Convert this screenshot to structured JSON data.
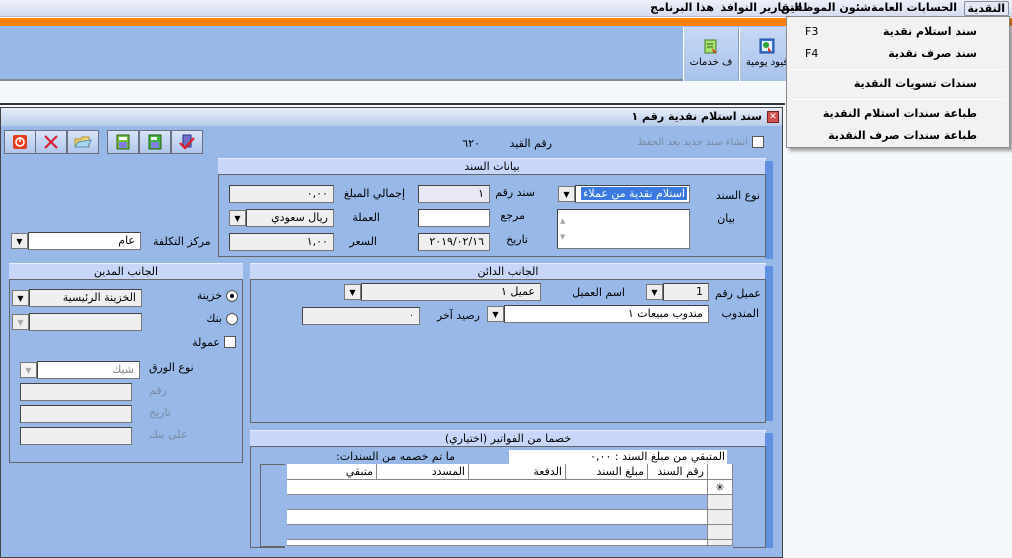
{
  "menubar": {
    "items": [
      {
        "label": "النقدية",
        "active": true
      },
      {
        "label": "الحسابات العامة"
      },
      {
        "label": "شئون الموظفين"
      },
      {
        "label": "التقارير"
      },
      {
        "label": "النوافذ"
      },
      {
        "label": "هذا البرنامج"
      }
    ]
  },
  "ribbon": {
    "buttons": [
      {
        "label": "قيود يومية",
        "icon": "journal-entries-icon"
      },
      {
        "label": "ف خدمات",
        "icon": "services-icon"
      }
    ]
  },
  "dropdown": {
    "items": [
      {
        "label": "سند استلام نقدية",
        "shortcut": "F3"
      },
      {
        "label": "سند صرف نقدية",
        "shortcut": "F4"
      },
      {
        "label": "سندات تسويات النقدية",
        "shortcut": ""
      },
      {
        "label": "طباعة سندات استلام النقدية",
        "shortcut": ""
      },
      {
        "label": "طباعة سندات صرف النقدية",
        "shortcut": ""
      }
    ]
  },
  "window": {
    "title": "سند استلام نقدية رقم ١",
    "close_glyph": "✕",
    "create_new_after_save_label": "انشاء سند جديد بعد الحفظ",
    "entry_number_label": "رقم القيد",
    "entry_number_value": "٦٢٠",
    "toolbar": [
      {
        "name": "exit-icon",
        "glyph": "⏻"
      },
      {
        "name": "delete-icon",
        "glyph": "✕"
      },
      {
        "name": "open-folder-icon",
        "glyph": "📂"
      },
      {
        "name": "save-new-icon",
        "glyph": "💾"
      },
      {
        "name": "save-icon",
        "glyph": "💾"
      },
      {
        "name": "post-approve-icon",
        "glyph": "✔"
      }
    ]
  },
  "voucher_data": {
    "header": "بيانات السند",
    "type_label": "نوع السند",
    "type_value": "استلام نقدية من عملاء",
    "description_label": "بيان",
    "description_value": "",
    "number_label": "سند رقم",
    "number_value": "١",
    "reference_label": "مرجع",
    "reference_value": "",
    "date_label": "تاريخ",
    "date_value": "٢٠١٩/٠٢/١٦",
    "total_label": "إجمالي المبلغ",
    "total_value": "٠,٠٠",
    "currency_label": "العملة",
    "currency_value": "ريال سعودي",
    "rate_label": "السعر",
    "rate_value": "١,٠٠"
  },
  "cost_center": {
    "label": "مركز التكلفة",
    "value": "عام"
  },
  "debit_side": {
    "header": "الجانب المدين",
    "treasury_label": "خزينة",
    "treasury_selected": true,
    "treasury_value": "الخزينة الرئيسية",
    "bank_label": "بنك",
    "bank_value": "",
    "commission_label": "عمولة",
    "paper_type_label": "نوع الورق",
    "paper_type_value": "شيك",
    "number_label": "رقم",
    "date_label": "تاريخ",
    "on_bank_label": "على بنك"
  },
  "credit_side": {
    "header": "الجانب الدائن",
    "customer_number_label": "عميل رقم",
    "customer_number_value": "1",
    "customer_name_label": "اسم العميل",
    "customer_name_value": "عميل ١",
    "rep_label": "المندوب",
    "rep_value": "مندوب مبيعات ١",
    "last_balance_label": "رصيد آخر",
    "last_balance_value": "٠"
  },
  "invoices": {
    "header": "خصما من الفواتير (اختياري)",
    "remaining_label": "المتبقي من مبلغ السند : ٠,٠٠",
    "deducted_label": "ما تم خصمه من السندات:",
    "columns": [
      "رقم السند",
      "مبلغ السند",
      "الدفعة",
      "المسدد",
      "متبقي"
    ],
    "new_row_marker": "✳",
    "rows": []
  },
  "colors": {
    "accent_orange": "#ff8000",
    "form_blue": "#98b8e8",
    "section_header": "#c8d6f8",
    "selection": "#3a7ae0"
  }
}
